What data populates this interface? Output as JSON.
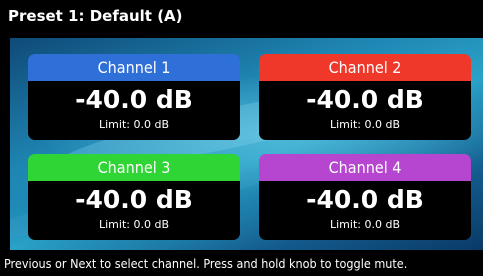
{
  "title": "Preset 1: Default (A)",
  "channels": [
    {
      "name": "Channel 1",
      "level": "-40.0 dB",
      "limit": "Limit: 0.0 dB",
      "color": "#2f6fd8"
    },
    {
      "name": "Channel 2",
      "level": "-40.0 dB",
      "limit": "Limit: 0.0 dB",
      "color": "#f0382a"
    },
    {
      "name": "Channel 3",
      "level": "-40.0 dB",
      "limit": "Limit: 0.0 dB",
      "color": "#2fd435"
    },
    {
      "name": "Channel 4",
      "level": "-40.0 dB",
      "limit": "Limit: 0.0 dB",
      "color": "#b646cf"
    }
  ],
  "status": "Previous or Next to select channel. Press and hold knob to toggle mute."
}
